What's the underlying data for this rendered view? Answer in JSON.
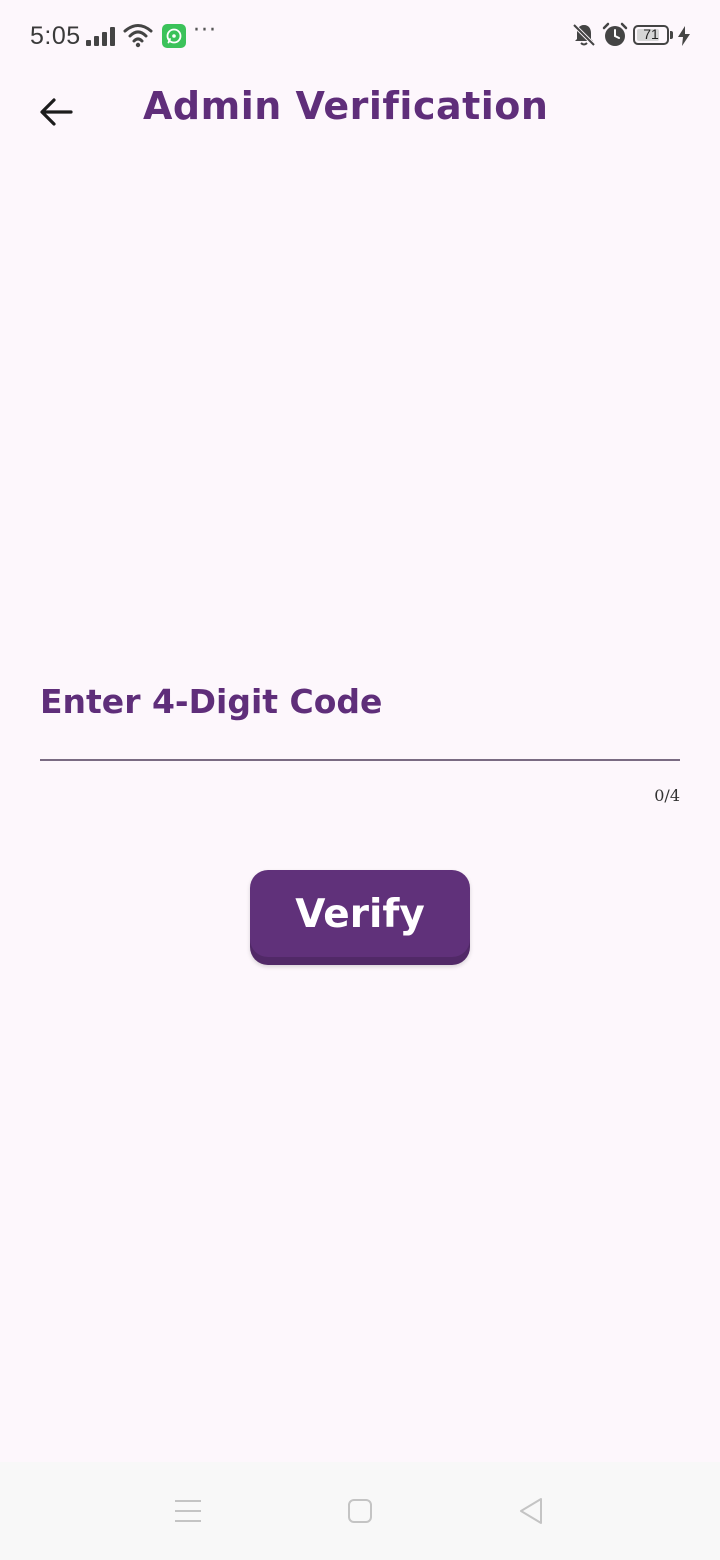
{
  "status_bar": {
    "time": "5:05",
    "battery_level": "71",
    "icons": [
      "signal-icon",
      "wifi-icon",
      "whatsapp-icon",
      "more-icon",
      "bell-off-icon",
      "alarm-icon",
      "battery-icon",
      "charge-icon"
    ],
    "more": "···"
  },
  "app_bar": {
    "title": "Admin Verification",
    "back_icon": "arrow-left-icon"
  },
  "form": {
    "code_label": "Enter 4-Digit Code",
    "code_value": "",
    "counter": "0/4",
    "verify_label": "Verify"
  },
  "nav_bar": {
    "icons": [
      "recents-icon",
      "home-icon",
      "back-icon"
    ]
  },
  "colors": {
    "accent": "#5f2e7a",
    "button": "#60317a",
    "background": "#fdf7fc"
  }
}
